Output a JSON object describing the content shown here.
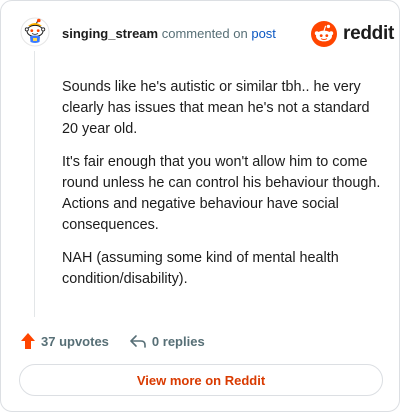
{
  "header": {
    "username": "singing_stream",
    "action_text": "commented on",
    "post_link": "post",
    "brand": "reddit"
  },
  "comment": {
    "paragraphs": [
      "Sounds like he's autistic or similar tbh.. he very clearly has issues that mean he's not a standard 20 year old.",
      "It's fair enough that you won't allow him to come round unless he can control his behaviour though. Actions and negative behaviour have social consequences.",
      "NAH (assuming some kind of mental health condition/disability)."
    ]
  },
  "footer": {
    "upvotes": "37 upvotes",
    "replies": "0 replies",
    "upvote_icon": "arrow-up-icon",
    "reply_icon": "reply-arrow-icon"
  },
  "view_more_label": "View more on Reddit",
  "colors": {
    "reddit_orange": "#ff4500",
    "upvote_orange": "#ff4500",
    "link_blue": "#0a57c2",
    "view_more_text": "#d93a00"
  }
}
